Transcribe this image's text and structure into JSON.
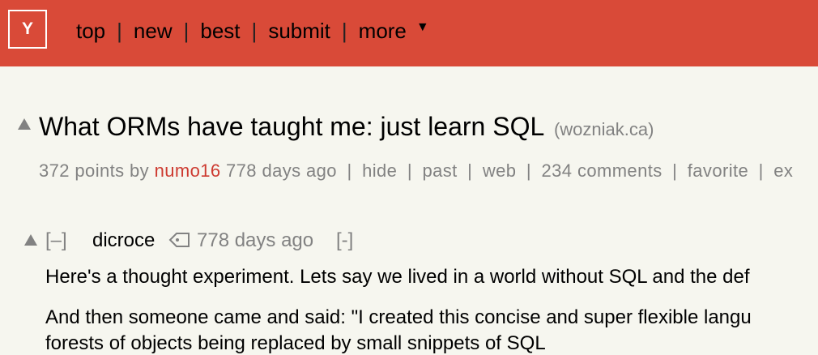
{
  "header": {
    "logo_text": "Y",
    "nav": [
      "top",
      "new",
      "best",
      "submit",
      "more"
    ],
    "separator": "|",
    "more_caret": "▼",
    "bg_color": "#d94a38"
  },
  "story": {
    "title": "What ORMs have taught me: just learn SQL",
    "site": "(wozniak.ca)",
    "points": "372 points",
    "by": "by",
    "user": "numo16",
    "age": "778 days ago",
    "links": [
      "hide",
      "past",
      "web",
      "234 comments",
      "favorite",
      "ex"
    ]
  },
  "comment": {
    "toggle": "[–]",
    "user": "dicroce",
    "age": "778 days ago",
    "toggle2": "[-]",
    "lines": [
      "Here's a thought experiment. Lets say we lived in a world without SQL and the def",
      "And then someone came and said: \"I created this concise and super flexible langu",
      "forests of objects being replaced by small snippets of SQL"
    ]
  }
}
